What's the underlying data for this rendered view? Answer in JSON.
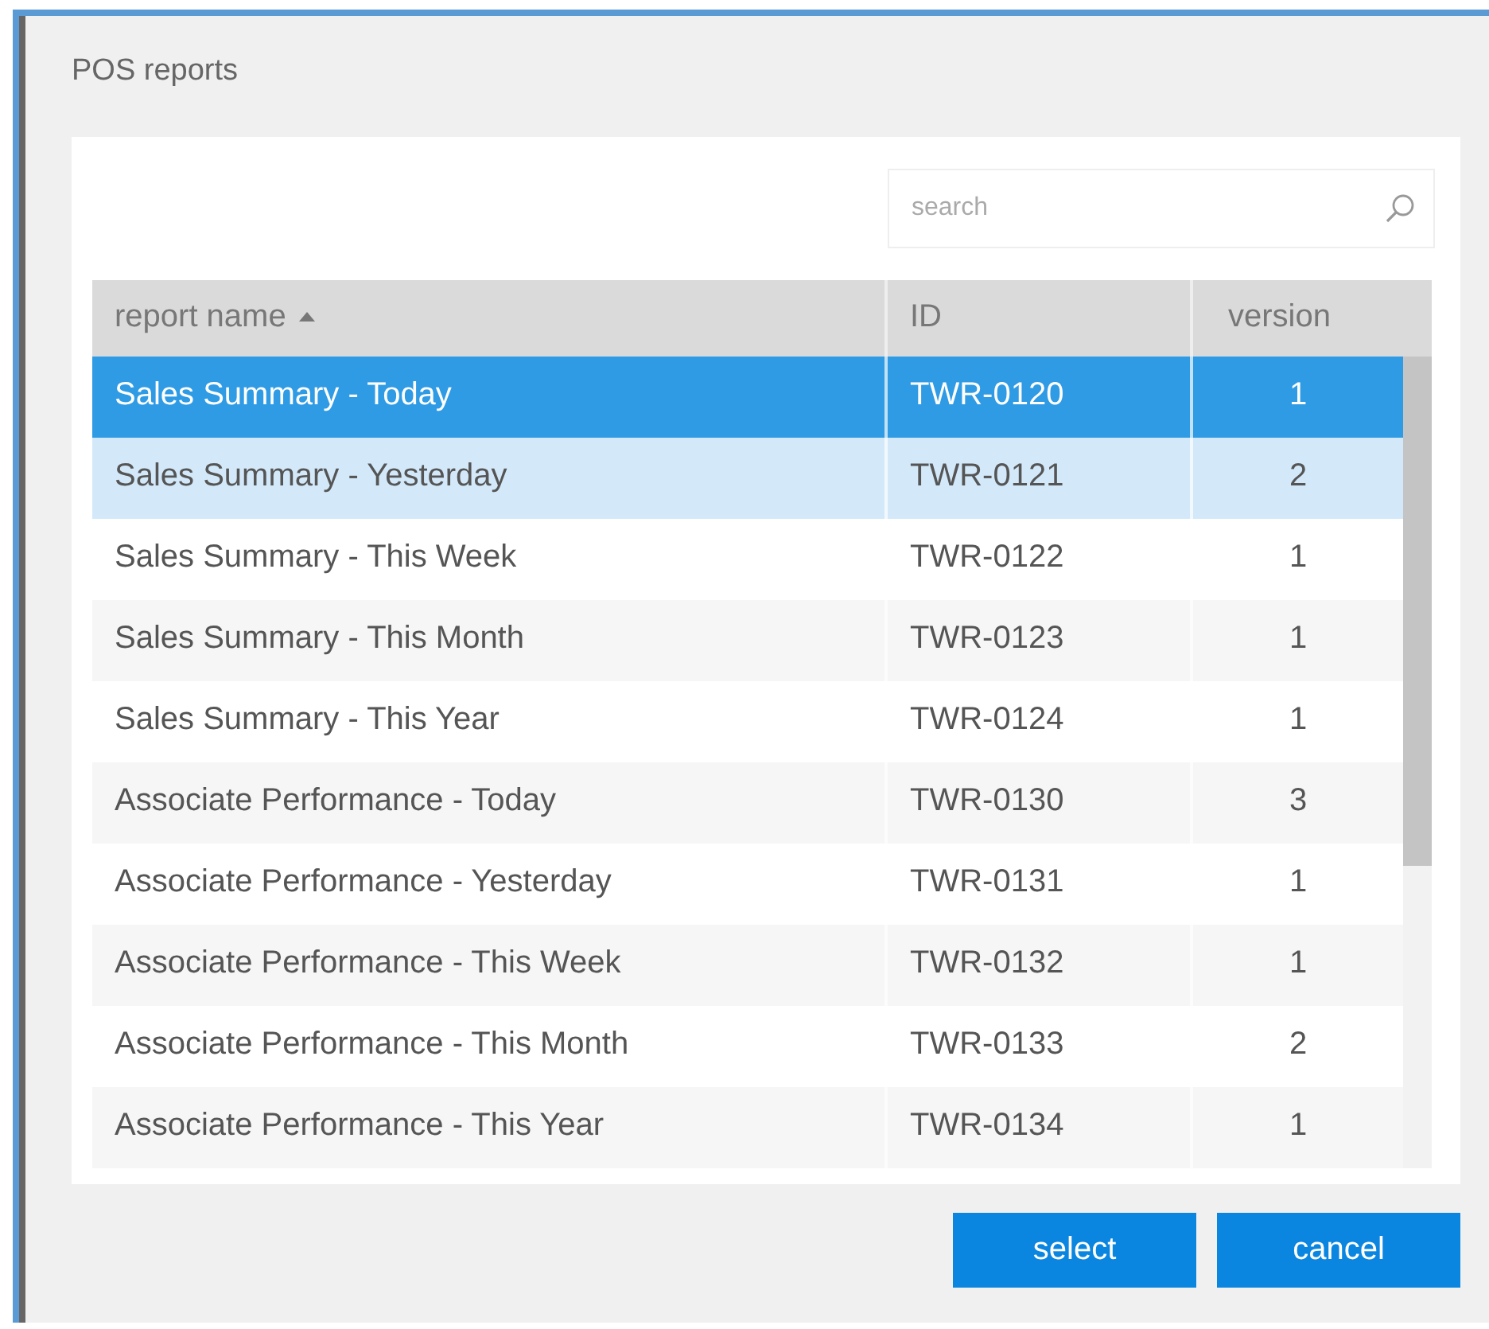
{
  "dialog": {
    "title": "POS reports"
  },
  "search": {
    "placeholder": "search"
  },
  "table": {
    "columns": [
      {
        "label": "report name",
        "sorted": true
      },
      {
        "label": "ID",
        "sorted": false
      },
      {
        "label": "version",
        "sorted": false
      }
    ],
    "rows": [
      {
        "name": "Sales Summary - Today",
        "id": "TWR-0120",
        "version": "1",
        "selected": true,
        "highlighted": false
      },
      {
        "name": "Sales Summary - Yesterday",
        "id": "TWR-0121",
        "version": "2",
        "selected": false,
        "highlighted": true
      },
      {
        "name": "Sales Summary - This Week",
        "id": "TWR-0122",
        "version": "1",
        "selected": false,
        "highlighted": false
      },
      {
        "name": "Sales Summary - This Month",
        "id": "TWR-0123",
        "version": "1",
        "selected": false,
        "highlighted": false
      },
      {
        "name": "Sales Summary - This Year",
        "id": "TWR-0124",
        "version": "1",
        "selected": false,
        "highlighted": false
      },
      {
        "name": "Associate Performance - Today",
        "id": "TWR-0130",
        "version": "3",
        "selected": false,
        "highlighted": false
      },
      {
        "name": "Associate Performance - Yesterday",
        "id": "TWR-0131",
        "version": "1",
        "selected": false,
        "highlighted": false
      },
      {
        "name": "Associate Performance - This Week",
        "id": "TWR-0132",
        "version": "1",
        "selected": false,
        "highlighted": false
      },
      {
        "name": "Associate Performance - This Month",
        "id": "TWR-0133",
        "version": "2",
        "selected": false,
        "highlighted": false
      },
      {
        "name": "Associate Performance - This Year",
        "id": "TWR-0134",
        "version": "1",
        "selected": false,
        "highlighted": false
      }
    ]
  },
  "buttons": [
    "select",
    "cancel"
  ]
}
